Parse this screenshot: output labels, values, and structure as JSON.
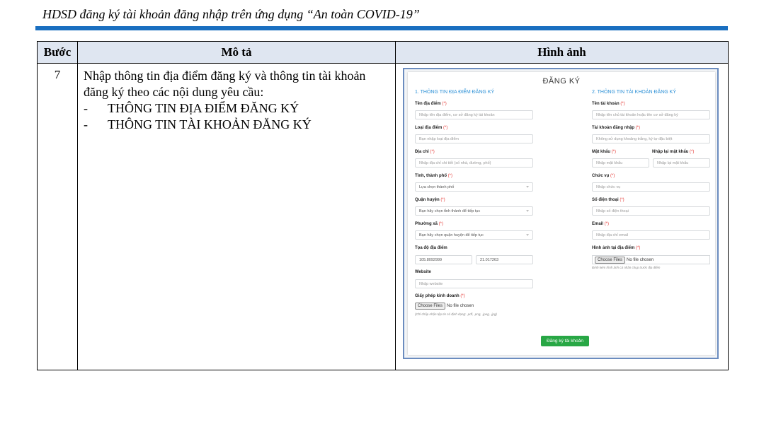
{
  "doc": {
    "title": "HDSD đăng ký tài khoản đăng nhập trên ứng dụng “An toàn COVID-19”"
  },
  "table": {
    "headers": [
      "Bước",
      "Mô tả",
      "Hình ảnh"
    ],
    "step": "7",
    "description": "Nhập thông tin địa điểm đăng ký và thông tin tài khoản đăng ký theo các nội dung yêu cầu:",
    "bullets": [
      "THÔNG TIN ĐỊA ĐIỂM ĐĂNG KÝ",
      "THÔNG TIN TÀI KHOẢN ĐĂNG KÝ"
    ]
  },
  "form": {
    "title": "ĐĂNG KÝ",
    "section1": "1. THÔNG TIN ĐỊA ĐIỂM ĐĂNG KÝ",
    "section2": "2. THÔNG TIN TÀI KHOẢN ĐĂNG KÝ",
    "required_mark": "(*)",
    "left": {
      "ten_dia_diem": {
        "label": "Tên địa điểm",
        "placeholder": "Nhập tên địa điểm, cơ sở đăng ký tài khoản"
      },
      "loai_dia_diem": {
        "label": "Loại địa điểm",
        "placeholder": "Bạn nhập loại địa điểm"
      },
      "dia_chi": {
        "label": "Địa chỉ",
        "placeholder": "Nhập địa chỉ chi tiết (số nhà, đường, phố)"
      },
      "tinh_thanh": {
        "label": "Tỉnh, thành phố",
        "value": "Lựa chọn thành phố"
      },
      "quan_huyen": {
        "label": "Quận huyện",
        "value": "Bạn hãy chọn tỉnh thành để tiếp tục"
      },
      "phuong_xa": {
        "label": "Phường xã",
        "value": "Bạn hãy chọn quận huyện để tiếp tục"
      },
      "toa_do": {
        "label": "Tọa độ địa điểm",
        "lng": "105.8092999",
        "lat": "21.017263"
      },
      "website": {
        "label": "Website",
        "placeholder": "Nhập website"
      },
      "giay_phep": {
        "label": "Giấy phép kinh doanh",
        "button": "Choose Files",
        "status": "No file chosen",
        "hint": "(Chỉ chấp nhận tệp tin có định dạng: .pdf, .png, .jpeg, .jpg)"
      }
    },
    "right": {
      "ten_tai_khoan": {
        "label": "Tên tài khoản",
        "placeholder": "Nhập tên chủ tài khoản hoặc tên cơ sở đăng ký"
      },
      "tai_khoan_dang_nhap": {
        "label": "Tài khoản đăng nhập",
        "placeholder": "Không sử dụng khoảng trắng, ký tự đặc biệt"
      },
      "mat_khau": {
        "label": "Mật khẩu",
        "placeholder": "Nhập mật khẩu"
      },
      "nhap_lai_mat_khau": {
        "label": "Nhập lại mật khẩu",
        "placeholder": "Nhập lại mật khẩu"
      },
      "chuc_vu": {
        "label": "Chức vụ",
        "placeholder": "Nhập chức vụ"
      },
      "so_dien_thoai": {
        "label": "Số điện thoại",
        "placeholder": "Nhập số điện thoại"
      },
      "email": {
        "label": "Email",
        "placeholder": "Nhập địa chỉ email"
      },
      "hinh_anh": {
        "label": "Hình ảnh tại địa điểm",
        "button": "Choose Files",
        "status": "No file chosen",
        "hint": "Đính kèm hình ảnh cá nhân chụp trước địa điểm"
      }
    },
    "submit": "Đăng ký tài khoản",
    "colors": {
      "accent": "#2a8fd6",
      "required": "#e53935",
      "submit": "#28a745",
      "header_rule": "#1a6fc0"
    }
  }
}
